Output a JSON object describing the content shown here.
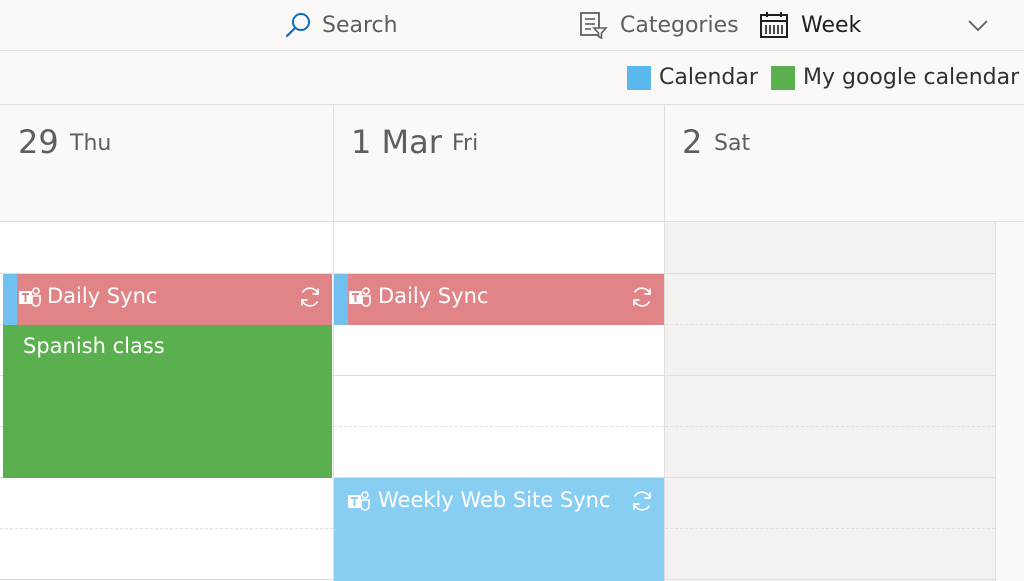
{
  "toolbar": {
    "search_label": "Search",
    "categories_label": "Categories",
    "view_label": "Week"
  },
  "legend": [
    {
      "label": "Calendar",
      "color": "#5bb8ec"
    },
    {
      "label": "My google calendar",
      "color": "#5aaf4e"
    }
  ],
  "days": [
    {
      "num": "29",
      "name": "Thu"
    },
    {
      "num": "1 Mar",
      "name": "Fri"
    },
    {
      "num": "2",
      "name": "Sat"
    }
  ],
  "events": {
    "thu_daily": {
      "title": "Daily Sync",
      "color": "#e08488",
      "calendar": "Calendar",
      "recurring": true,
      "teams": true
    },
    "thu_spanish": {
      "title": "Spanish class",
      "color": "#5aaf4e",
      "calendar": "My google calendar"
    },
    "fri_daily": {
      "title": "Daily Sync",
      "color": "#e08488",
      "calendar": "Calendar",
      "recurring": true,
      "teams": true
    },
    "fri_weekly": {
      "title": "Weekly Web Site Sync",
      "color": "#88cdf2",
      "calendar": "Calendar",
      "recurring": true,
      "teams": true
    }
  },
  "icons": {
    "search": "search-icon",
    "categories": "categories-filter-icon",
    "view": "calendar-week-icon",
    "dropdown": "chevron-down-icon",
    "teams": "teams-icon",
    "recurring": "recurring-icon"
  }
}
